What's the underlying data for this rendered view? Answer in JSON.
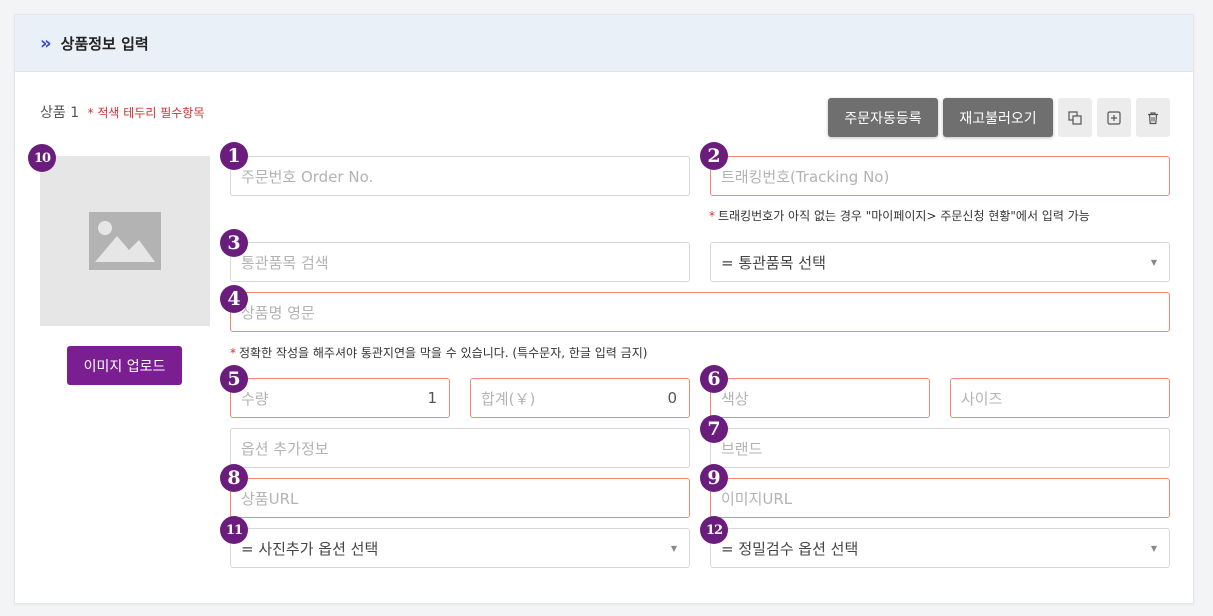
{
  "header": {
    "title": "상품정보 입력"
  },
  "product": {
    "label": "상품 1",
    "required_note": "* 적색 테두리 필수항목"
  },
  "toolbar": {
    "order_auto_register": "주문자동등록",
    "load_inventory": "재고불러오기"
  },
  "image": {
    "upload_label": "이미지 업로드"
  },
  "markers": [
    "1",
    "2",
    "3",
    "4",
    "5",
    "6",
    "7",
    "8",
    "9",
    "10",
    "11",
    "12"
  ],
  "fields": {
    "order_no": {
      "placeholder": "주문번호 Order No."
    },
    "tracking_no": {
      "placeholder": "트래킹번호(Tracking No)"
    },
    "tracking_note": "트래킹번호가 아직 없는 경우 \"마이페이지> 주문신청 현황\"에서 입력 가능",
    "customs_search": {
      "placeholder": "통관품목 검색"
    },
    "customs_select": {
      "value": "= 통관품목 선택"
    },
    "name_en": {
      "placeholder": "상품명 영문"
    },
    "name_note": "정확한 작성을 해주셔야 통관지연을 막을 수 있습니다. (특수문자, 한글 입력 금지)",
    "quantity": {
      "placeholder": "수량",
      "value": "1"
    },
    "total": {
      "placeholder": "합계(￥)",
      "value": "0"
    },
    "color": {
      "placeholder": "색상"
    },
    "size": {
      "placeholder": "사이즈"
    },
    "option_info": {
      "placeholder": "옵션 추가정보"
    },
    "brand": {
      "placeholder": "브랜드"
    },
    "product_url": {
      "placeholder": "상품URL"
    },
    "image_url": {
      "placeholder": "이미지URL"
    },
    "photo_option": {
      "value": "= 사진추가 옵션 선택"
    },
    "inspection_option": {
      "value": "= 정밀검수 옵션 선택"
    }
  }
}
